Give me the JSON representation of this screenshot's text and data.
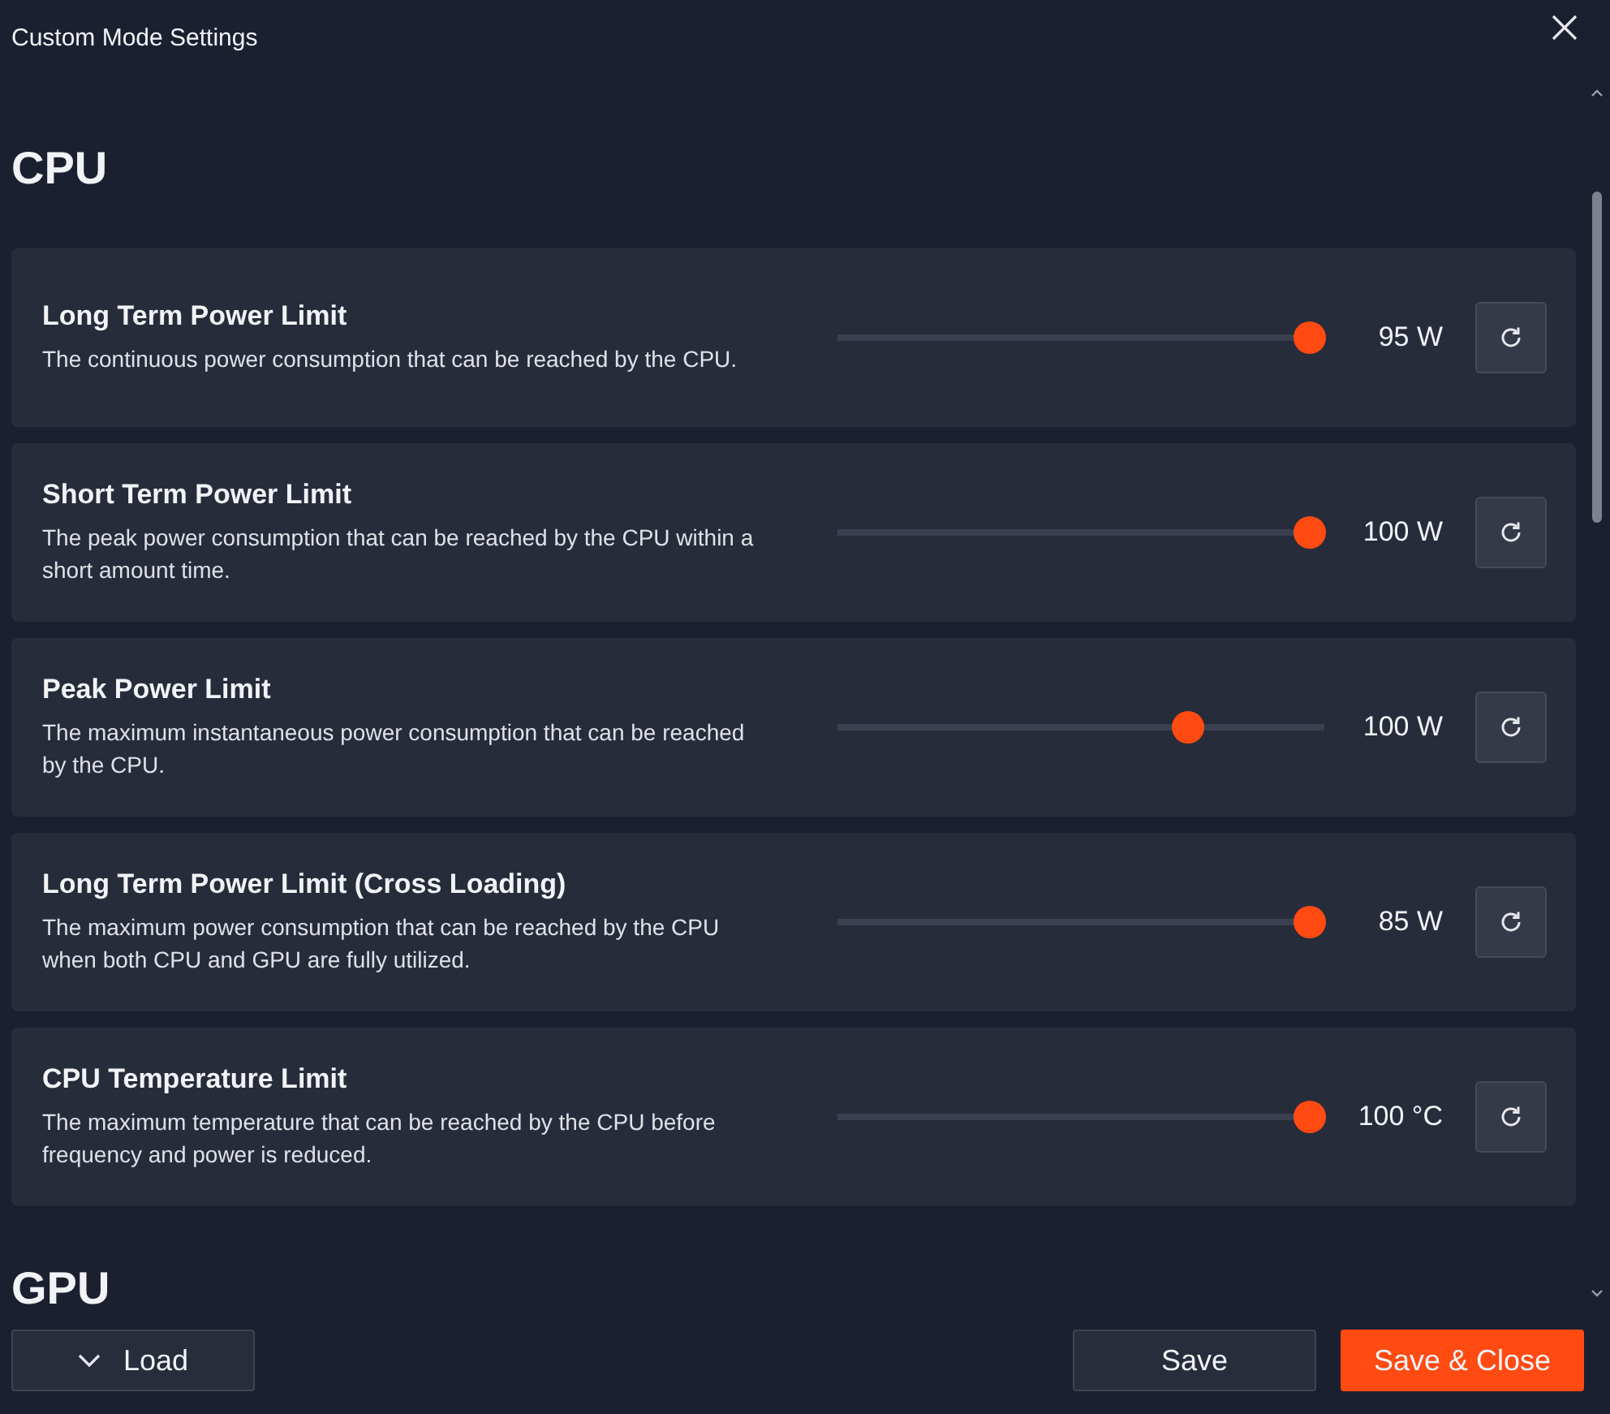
{
  "window": {
    "title": "Custom Mode Settings"
  },
  "sections": [
    {
      "heading": "CPU",
      "settings": [
        {
          "title": "Long Term Power Limit",
          "description": "The continuous power consumption that can be reached by the CPU.",
          "level": 0.97,
          "value": "95 W"
        },
        {
          "title": "Short Term Power Limit",
          "description": "The peak power consumption that can be reached by the CPU within a short amount time.",
          "level": 0.97,
          "value": "100 W"
        },
        {
          "title": "Peak Power Limit",
          "description": "The maximum instantaneous power consumption that can be reached by the CPU.",
          "level": 0.72,
          "value": "100 W"
        },
        {
          "title": "Long Term Power Limit (Cross Loading)",
          "description": "The maximum power consumption that can be reached by the CPU when both CPU and GPU are fully utilized.",
          "level": 0.97,
          "value": "85 W"
        },
        {
          "title": "CPU Temperature Limit",
          "description": "The maximum temperature that can be reached by the CPU before frequency and power is reduced.",
          "level": 0.97,
          "value": "100 °C"
        }
      ]
    },
    {
      "heading": "GPU"
    }
  ],
  "load_button": {
    "label": "Load"
  },
  "buttons": [
    {
      "label": "Save",
      "kind": "secondary"
    },
    {
      "label": "Save & Close",
      "kind": "primary"
    }
  ]
}
